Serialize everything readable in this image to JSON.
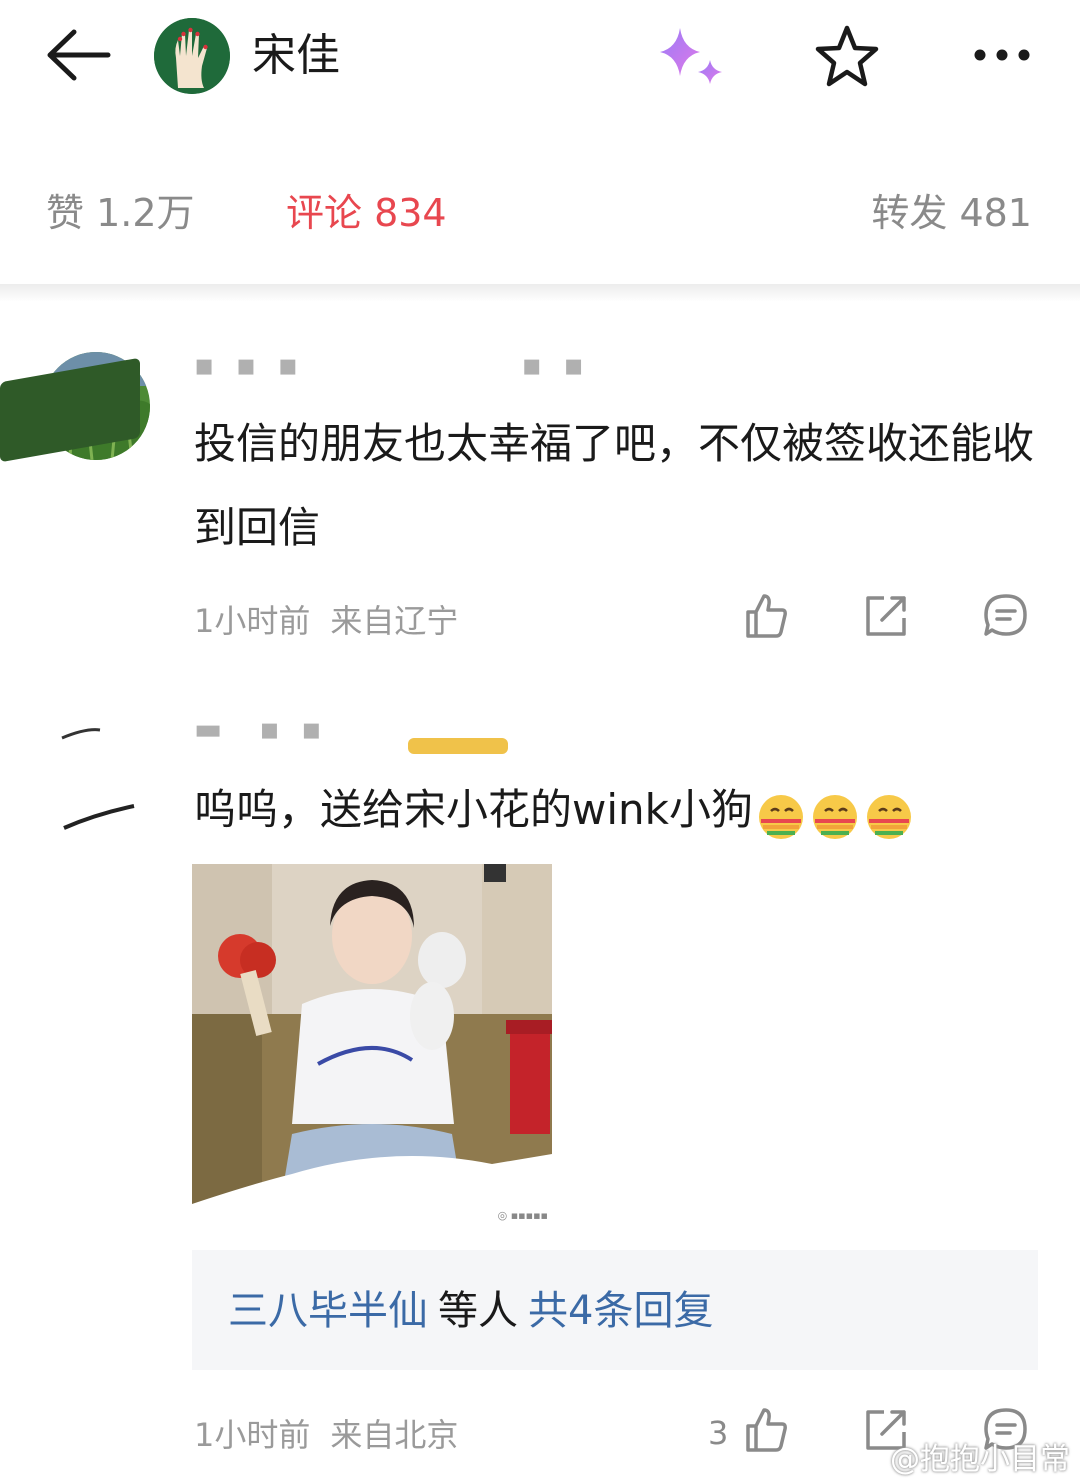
{
  "header": {
    "title": "宋佳",
    "icons": {
      "back": "back-arrow-icon",
      "sparkle": "sparkle-icon",
      "star": "star-icon",
      "more": "more-icon"
    },
    "colors": {
      "sparkle": "#b07cf5",
      "avatar_bg": "#1f6a3a"
    }
  },
  "tabs": {
    "likes": "赞 1.2万",
    "comments": "评论 834",
    "reposts": "转发 481",
    "active_color": "#e8474f"
  },
  "comments": [
    {
      "text": "投信的朋友也太幸福了吧，不仅被签收还能收到回信",
      "time": "1小时前",
      "location": "来自辽宁"
    },
    {
      "text": "呜呜，送给宋小花的wink小狗",
      "emojis": [
        "rainbow-kiss-emoji",
        "rainbow-kiss-emoji",
        "rainbow-kiss-emoji"
      ],
      "reply_user": "三八毕半仙",
      "reply_mid": "等人",
      "reply_count": "共4条回复",
      "time": "1小时前",
      "location": "来自北京",
      "like_count": "3"
    }
  ],
  "watermark": "@抱抱小目常",
  "link_color": "#3b6aa6"
}
